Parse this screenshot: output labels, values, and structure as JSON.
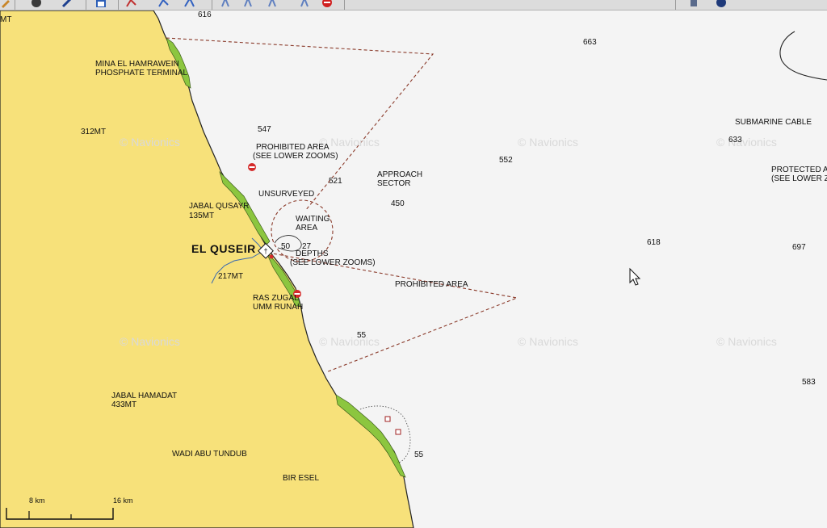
{
  "toolbar": {
    "icons": [
      "pencil-icon",
      "compass-icon",
      "ruler-icon",
      "save-icon",
      "route-icon",
      "waypoint-icon",
      "track-icon",
      "marker-icon",
      "no-entry-icon",
      "anchor-icon",
      "globe-icon"
    ]
  },
  "labels": {
    "mt_left": "MT",
    "mina": "MINA EL HAMRAWEIN",
    "phosphate": "PHOSPHATE TERMINAL",
    "m312": "312MT",
    "prohibited_area": "PROHIBITED AREA",
    "see_lower_zooms_1": "(SEE LOWER ZOOMS)",
    "unsurveyed": "UNSURVEYED",
    "jabal_qusayr": "JABAL QUSAYR",
    "m135": "135MT",
    "waiting": "WAITING",
    "area": "AREA",
    "approach": "APPROACH",
    "sector": "SECTOR",
    "el_quseir": "EL QUSEIR",
    "depths": "DEPTHS",
    "see_lower_zooms_2": "(SEE LOWER ZOOMS)",
    "m217": "217MT",
    "ras_zugal": "RAS ZUGAL",
    "umm_runah": "UMM RUNAH",
    "prohibited_area_2": "PROHIBITED AREA",
    "submarine_cable": "SUBMARINE CABLE",
    "protected_a": "PROTECTED A",
    "see_lower_3": "(SEE LOWER Z",
    "jabal_hamadat": "JABAL HAMADAT",
    "m433": "433MT",
    "wadi_abu_tundub": "WADI ABU TUNDUB",
    "bir_esel": "BIR ESEL"
  },
  "depths": {
    "d616": "616",
    "d663": "663",
    "d547": "547",
    "d552": "552",
    "d633": "633",
    "d521": "521",
    "d450": "450",
    "d618": "618",
    "d697": "697",
    "d50": "50",
    "d27": "27",
    "d55a": "55",
    "d583": "583",
    "d55b": "55"
  },
  "watermark": "© Navionics",
  "scale": {
    "left": "8 km",
    "right": "16 km"
  },
  "colors": {
    "land": "#f7e17a",
    "sea": "#f4f4f4",
    "reef": "#8cc63f",
    "boundary": "#8a3a2a",
    "coast": "#222222"
  }
}
